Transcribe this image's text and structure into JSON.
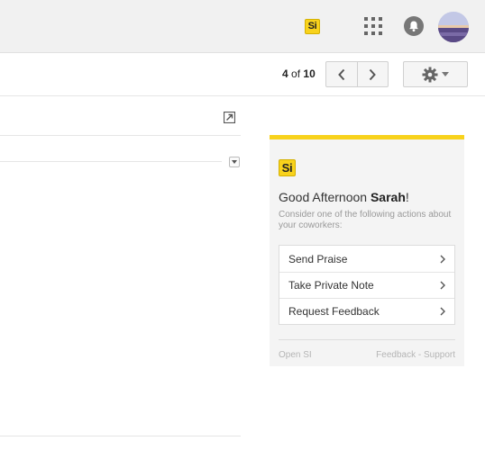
{
  "header": {
    "si_badge": "Si",
    "icons": [
      "apps-grid-icon",
      "notifications-bell-icon",
      "account-avatar"
    ]
  },
  "toolbar": {
    "pager_current": "4",
    "pager_of": "of",
    "pager_total": "10",
    "icons": [
      "chevron-left-icon",
      "chevron-right-icon",
      "gear-icon",
      "caret-down-icon"
    ]
  },
  "message": {
    "icons": [
      "popout-icon",
      "dropdown-arrow-icon"
    ]
  },
  "widget": {
    "accent_color": "#f8d21c",
    "logo": "Si",
    "greeting_prefix": "Good Afternoon ",
    "greeting_name": "Sarah",
    "greeting_suffix": "!",
    "subtitle": "Consider one of the following actions about your coworkers:",
    "actions": [
      {
        "label": "Send Praise"
      },
      {
        "label": "Take Private Note"
      },
      {
        "label": "Request Feedback"
      }
    ],
    "footer_left": "Open SI",
    "footer_right": "Feedback - Support"
  }
}
